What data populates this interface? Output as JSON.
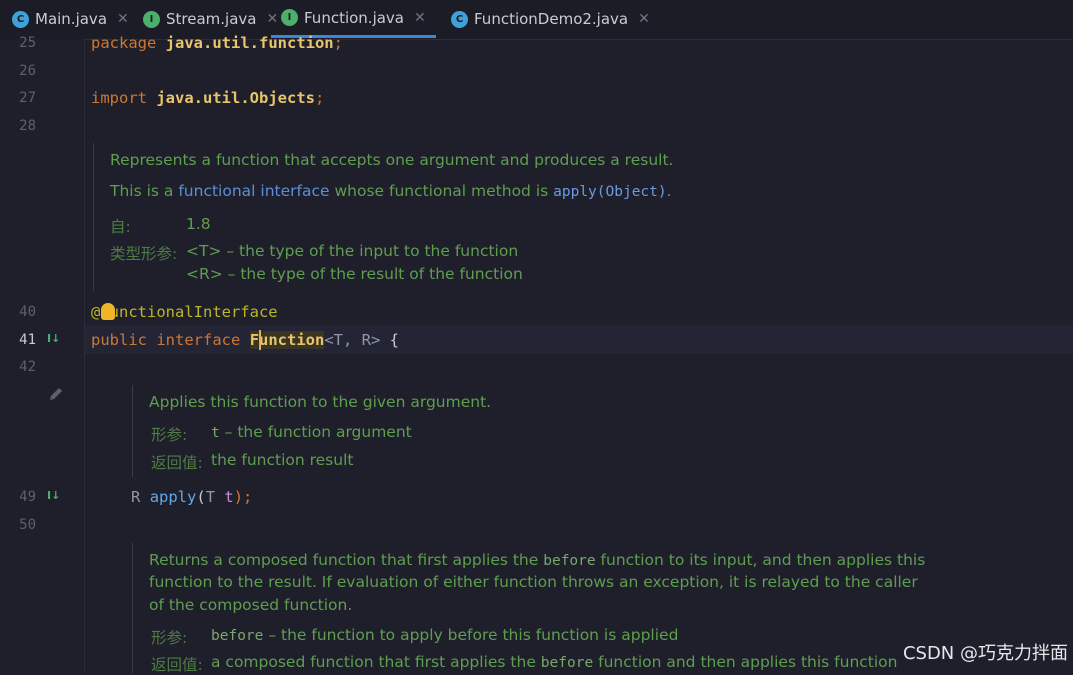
{
  "tabs": [
    {
      "icon": "class-icon",
      "label": "Main.java"
    },
    {
      "icon": "interface-icon",
      "label": "Stream.java"
    },
    {
      "icon": "interface-icon",
      "label": "Function.java",
      "active": true
    },
    {
      "icon": "class-icon",
      "label": "FunctionDemo2.java"
    }
  ],
  "tab_close": "✕",
  "line_numbers": [
    "25",
    "26",
    "27",
    "28",
    "40",
    "41",
    "42",
    "49",
    "50"
  ],
  "code": {
    "l25_kw": "package",
    "l25_pkg": "java.util.function",
    "l25_semi": ";",
    "l27_kw": "import",
    "l27_pkg": "java.util.Objects",
    "l27_semi": ";",
    "l40": "@FunctionalInterface",
    "l41_kw1": "public",
    "l41_kw2": "interface",
    "l41_name": "Function",
    "l41_t": "<T, R>",
    "l41_brace": " {",
    "l49_r": "R",
    "l49_m": "apply",
    "l49_p1": "(",
    "l49_t": "T",
    "l49_arg": " t",
    "l49_end": ");"
  },
  "doc1": {
    "line1": "Represents a function that accepts one argument and produces a result.",
    "line2_a": "This is a ",
    "line2_link": "functional interface",
    "line2_b": " whose functional method is ",
    "line2_code": "apply(Object)",
    "line2_c": ".",
    "since_label": "自:",
    "since_value": "1.8",
    "tparams_label": "类型形参:",
    "tparam1": "<T> – the type of the input to the function",
    "tparam2": "<R> – the type of the result of the function"
  },
  "doc2": {
    "line1": "Applies this function to the given argument.",
    "params_label": "形参:",
    "param_code": "t",
    "param_text": " – the function argument",
    "returns_label": "返回值:",
    "returns_text": "the function result"
  },
  "doc3": {
    "l1_a": "Returns a composed function that first applies the ",
    "l1_code": "before",
    "l1_b": " function to its input, and then applies this",
    "l2": "function to the result. If evaluation of either function throws an exception, it is relayed to the caller",
    "l3": "of the composed function.",
    "params_label": "形参:",
    "param_code": "before",
    "param_text": " – the function to apply before this function is applied",
    "returns_label": "返回值:",
    "ret_a": "a composed function that first applies the ",
    "ret_code": "before",
    "ret_b": " function and then applies this function"
  },
  "watermark": "CSDN @巧克力拌面",
  "colors": {
    "background": "#1e1f2b",
    "keyword": "#cc7832",
    "doc_text": "#5f9e4f",
    "tab_underline": "#3d86d6"
  }
}
